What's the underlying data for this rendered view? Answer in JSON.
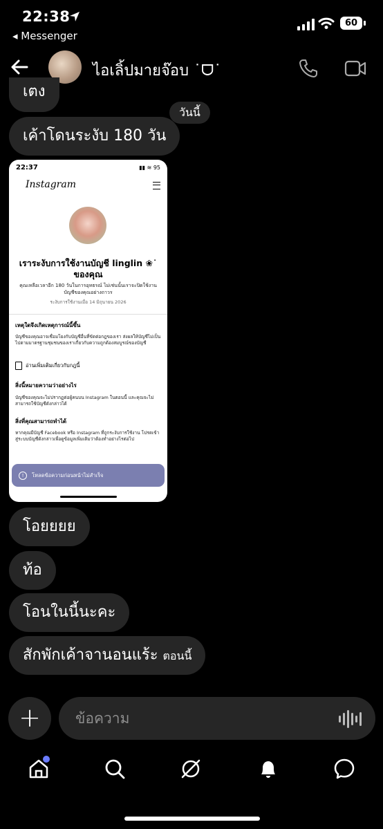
{
  "status_bar": {
    "time": "22:38",
    "back_app": "◂ Messenger",
    "battery": "60"
  },
  "header": {
    "title": "ไอเลิ้ปมายจ๊อบ ˙ᗜ˙",
    "avatar": "avatar"
  },
  "messages": [
    {
      "text": "เตง",
      "from": "other"
    },
    {
      "text": "วันนี้",
      "from": "reaction"
    },
    {
      "text": "เค้าโดนระงับ 180 วัน",
      "from": "other"
    },
    {
      "text": "โอยยยย",
      "from": "other"
    },
    {
      "text": "ท้อ",
      "from": "other"
    },
    {
      "text": "โอนในนี้นะคะ",
      "from": "other"
    },
    {
      "text": "สักพักเค้าจานอนแร้ะ",
      "suffix": "ตอนนี้",
      "from": "other"
    }
  ],
  "shared_screenshot": {
    "time": "22:37",
    "status_right": "▮▮ ≋ 95",
    "brand": "Instagram",
    "heading": "เราระงับการใช้งานบัญชี linglin ❀˙ ของคุณ",
    "sub": "คุณเหลือเวลาอีก 180 วันในการอุทธรณ์ ไม่เช่นนั้นเราจะปิดใช้งานบัญชีของคุณอย่างถาวร",
    "date": "ระงับการใช้งานเมื่อ 14 มิถุนายน 2026",
    "sec1_title": "เหตุใดจึงเกิดเหตุการณ์นี้ขึ้น",
    "sec1_body": "บัญชีของคุณอาจเชื่อมโยงกับบัญชีอื่นที่ขัดต่อกฎของเรา ส่งผลให้บัญชีไม่เป็นไปตามมาตรฐานชุมชนของเราเกี่ยวกับความถูกต้องสมบูรณ์ของบัญชี",
    "link": "อ่านเพิ่มเติมเกี่ยวกับกฎนี้",
    "sec2_title": "สิ่งนี้หมายความว่าอย่างไร",
    "sec2_body": "บัญชีของคุณจะไม่ปรากฏต่อผู้คนบน Instagram ในตอนนี้ และคุณจะไม่สามารถใช้บัญชีดังกล่าวได้",
    "sec3_title": "สิ่งที่คุณสามารถทำได้",
    "sec3_body": "หากคุณมีบัญชี Facebook หรือ Instagram ที่ถูกระงับการใช้งาน โปรดเข้าสู่ระบบบัญชีดังกล่าวเพื่อดูข้อมูลเพิ่มเติมว่าต้องทำอย่างไรต่อไป",
    "toast": "โหลดข้อความก่อนหน้าไม่สำเร็จ"
  },
  "composer": {
    "placeholder": "ข้อความ"
  },
  "tabs": [
    "home-icon",
    "search-icon",
    "explore-icon",
    "notifications-icon",
    "messages-icon"
  ],
  "colors": {
    "bubble": "#262626",
    "accent_dot": "#6b7cff"
  }
}
